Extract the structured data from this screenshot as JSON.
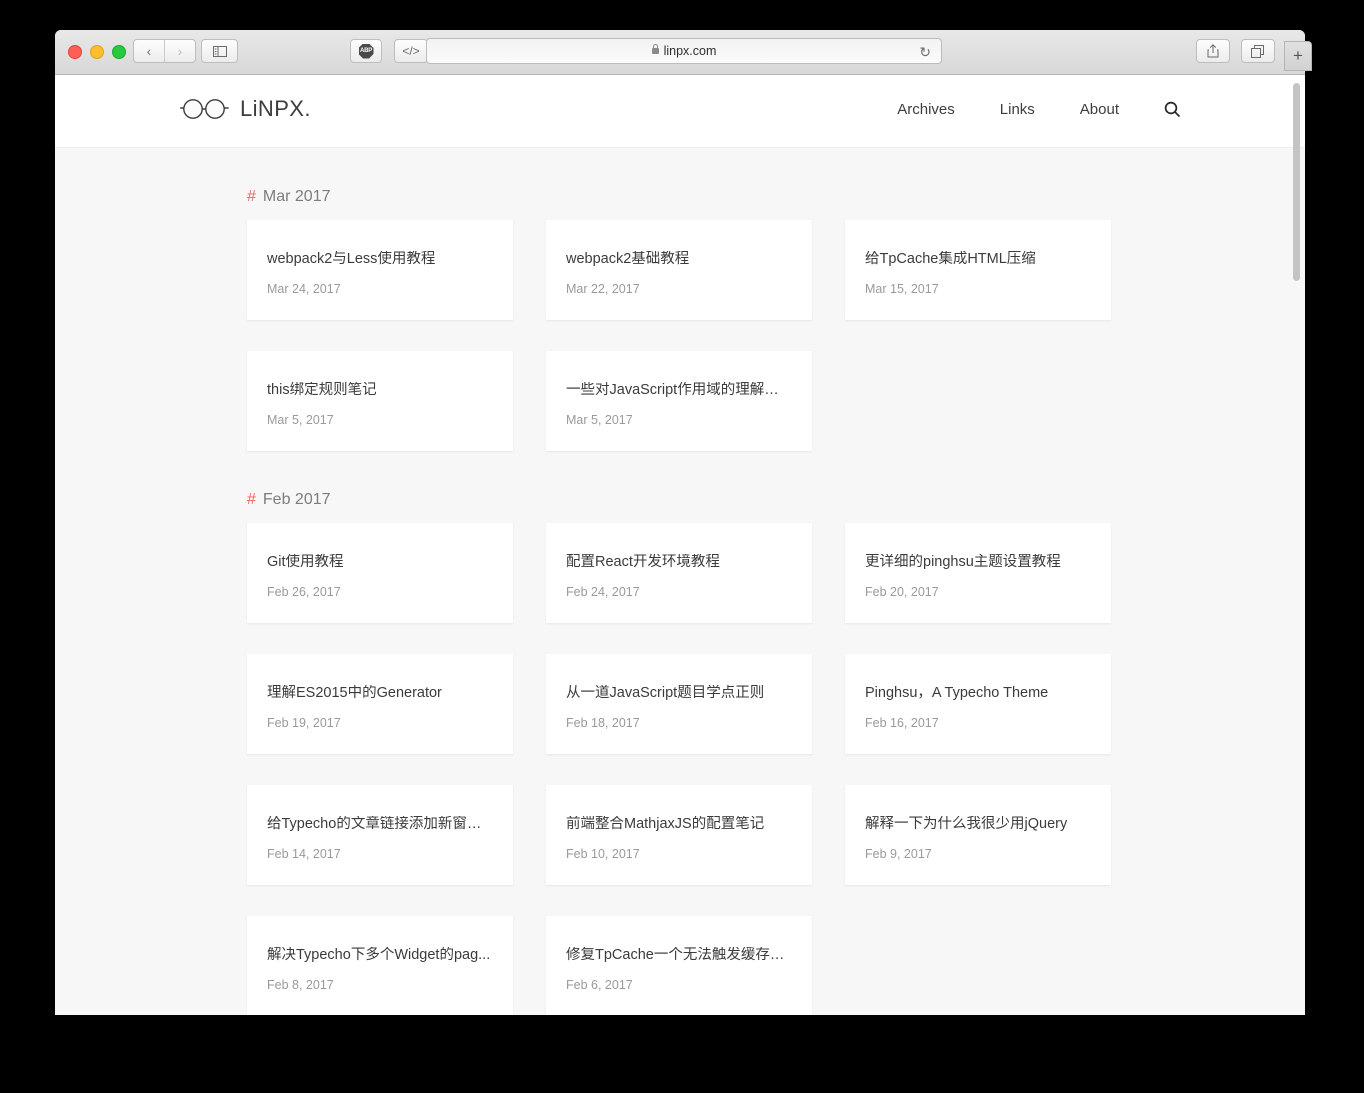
{
  "browser": {
    "url": "linpx.com",
    "toolbar": {
      "back_label": "‹",
      "forward_label": "›",
      "sidebar_icon": "sidebar-icon",
      "abp_label": "ABP",
      "code_label": "</>",
      "swap_label": "⇄",
      "share_label": "⇧",
      "tabs_label": "❐",
      "reload_label": "↻",
      "newtab_label": "+"
    }
  },
  "site": {
    "logo_text": "LiNPX.",
    "nav": [
      {
        "label": "Archives"
      },
      {
        "label": "Links"
      },
      {
        "label": "About"
      }
    ],
    "search_icon": "search-icon"
  },
  "sections": [
    {
      "hash": "#",
      "title": "Mar 2017",
      "posts": [
        {
          "title": "webpack2与Less使用教程",
          "date": "Mar 24, 2017"
        },
        {
          "title": "webpack2基础教程",
          "date": "Mar 22, 2017"
        },
        {
          "title": "给TpCache集成HTML压缩",
          "date": "Mar 15, 2017"
        },
        {
          "title": "this绑定规则笔记",
          "date": "Mar 5, 2017"
        },
        {
          "title": "一些对JavaScript作用域的理解笔记",
          "date": "Mar 5, 2017"
        }
      ]
    },
    {
      "hash": "#",
      "title": "Feb 2017",
      "posts": [
        {
          "title": "Git使用教程",
          "date": "Feb 26, 2017"
        },
        {
          "title": "配置React开发环境教程",
          "date": "Feb 24, 2017"
        },
        {
          "title": "更详细的pinghsu主题设置教程",
          "date": "Feb 20, 2017"
        },
        {
          "title": "理解ES2015中的Generator",
          "date": "Feb 19, 2017"
        },
        {
          "title": "从一道JavaScript题目学点正则",
          "date": "Feb 18, 2017"
        },
        {
          "title": "Pinghsu，A Typecho Theme",
          "date": "Feb 16, 2017"
        },
        {
          "title": "给Typecho的文章链接添加新窗口...",
          "date": "Feb 14, 2017"
        },
        {
          "title": "前端整合MathjaxJS的配置笔记",
          "date": "Feb 10, 2017"
        },
        {
          "title": "解释一下为什么我很少用jQuery",
          "date": "Feb 9, 2017"
        },
        {
          "title": "解决Typecho下多个Widget的pag...",
          "date": "Feb 8, 2017"
        },
        {
          "title": "修复TpCache一个无法触发缓存刷...",
          "date": "Feb 6, 2017"
        }
      ]
    }
  ],
  "colors": {
    "accent": "#e8685d",
    "page_bg": "#f7f7f7",
    "card_bg": "#ffffff",
    "title_text": "#3b3b3b",
    "date_text": "#9a9a9a"
  }
}
